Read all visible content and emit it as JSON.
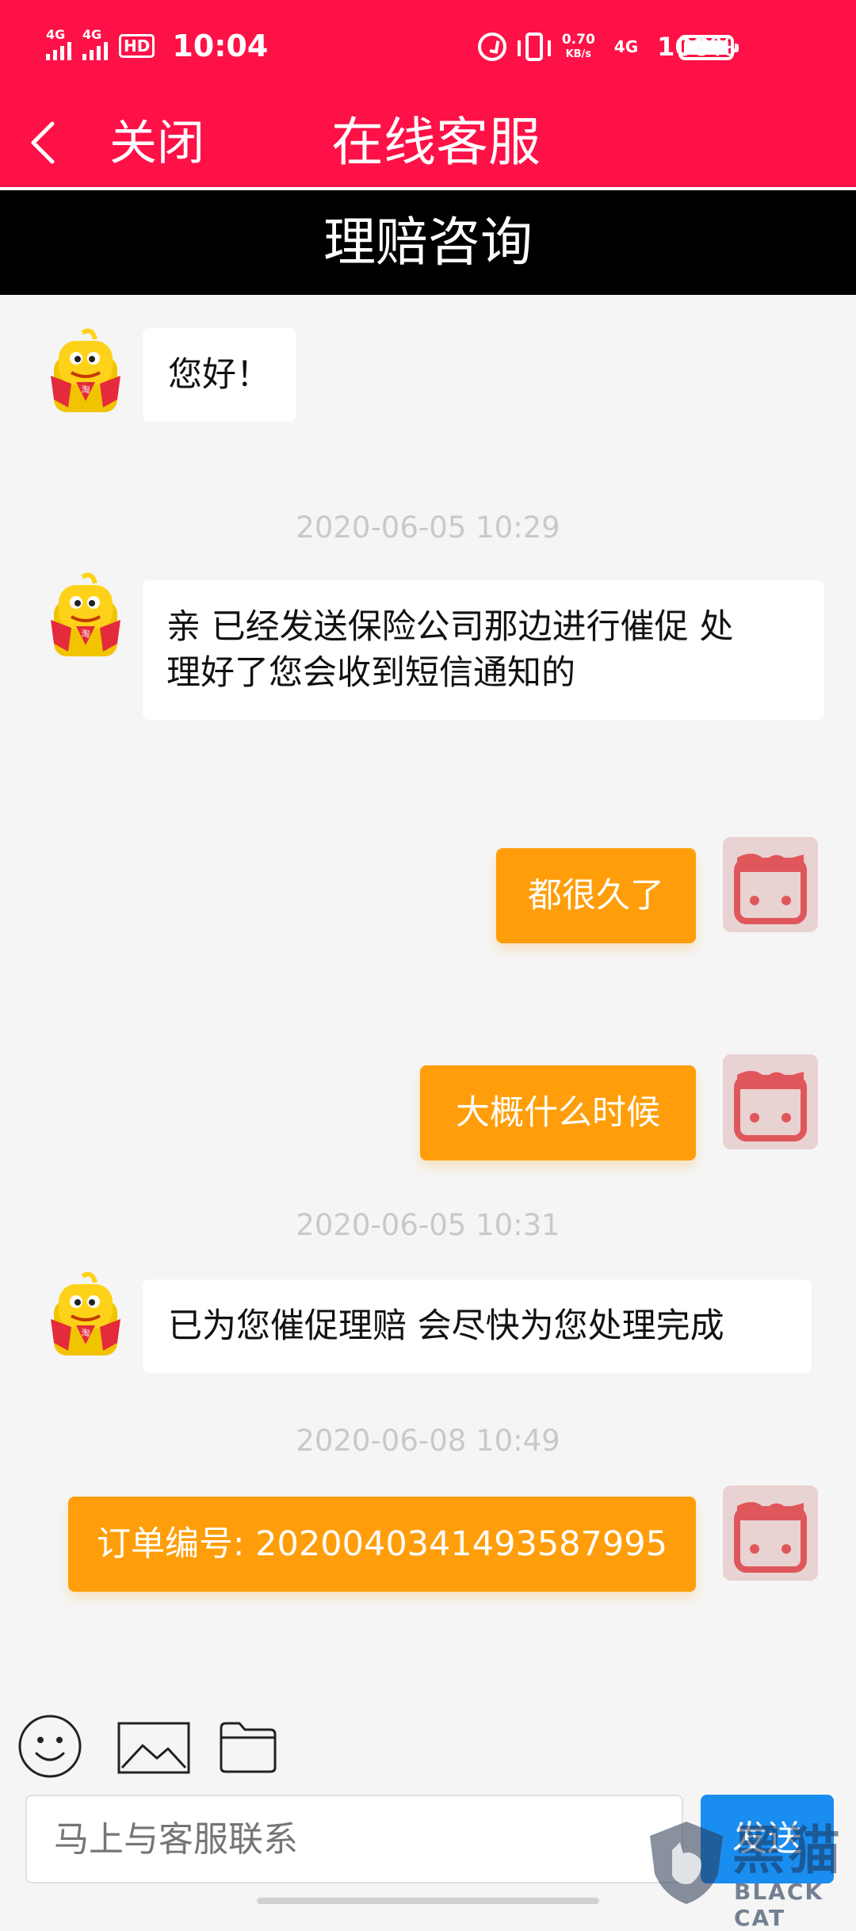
{
  "status_bar": {
    "signal1_label": "4G",
    "signal2_label": "4G",
    "hd_label": "HD",
    "time": "10:04",
    "net_speed_value": "0.70",
    "net_speed_unit": "KB/s",
    "net_type": "4G",
    "battery_percent": "100%",
    "battery_level": 1.0,
    "icons": [
      "signal-icon",
      "signal-icon",
      "hd-voice-icon",
      "alarm-icon",
      "vibrate-icon",
      "battery-icon"
    ]
  },
  "nav": {
    "back_icon": "chevron-left-icon",
    "close_label": "关闭",
    "title": "在线客服"
  },
  "topic": {
    "title": "理赔咨询"
  },
  "messages": [
    {
      "side": "agent",
      "text": "您好！"
    },
    {
      "timestamp": "2020-06-05 10:29"
    },
    {
      "side": "agent",
      "text_line1": "亲 已经发送保险公司那边进行催促 处",
      "text_line2": "理好了您会收到短信通知的"
    },
    {
      "side": "user",
      "text": "都很久了"
    },
    {
      "side": "user",
      "text": "大概什么时候"
    },
    {
      "timestamp": "2020-06-05 10:31"
    },
    {
      "side": "agent",
      "text": "已为您催促理赔 会尽快为您处理完成"
    },
    {
      "timestamp": "2020-06-08 10:49"
    },
    {
      "side": "user",
      "text": "订单编号: 2020040341493587995"
    }
  ],
  "toolbar": {
    "icons": [
      "emoji-icon",
      "image-icon",
      "folder-icon"
    ]
  },
  "composer": {
    "placeholder": "马上与客服联系",
    "send_label": "发送"
  },
  "watermark": {
    "text": "黑猫",
    "sub": "BLACK CAT"
  },
  "colors": {
    "header": "#fe1147",
    "topic_bar": "#000000",
    "user_bubble": "#ff9e0a",
    "agent_bubble": "#ffffff",
    "send_button": "#1a8df0",
    "timestamp": "#c9c9c9"
  }
}
